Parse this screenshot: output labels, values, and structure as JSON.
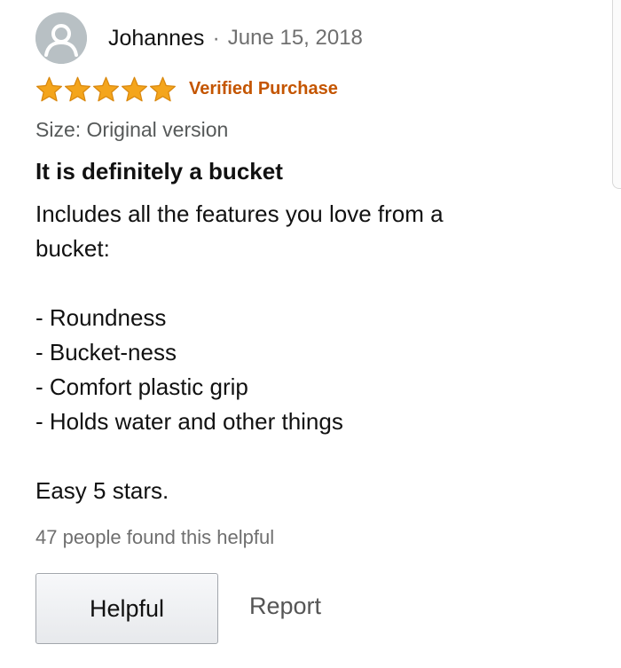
{
  "review": {
    "reviewer_name": "Johannes",
    "separator": "·",
    "date": "June 15, 2018",
    "rating": 5,
    "rating_max": 5,
    "verified_label": "Verified Purchase",
    "size_line": "Size: Original version",
    "title": "It is definitely a bucket",
    "body_lines": [
      "Includes all the features you love from a",
      "bucket:",
      "",
      "- Roundness",
      "- Bucket-ness",
      "- Comfort plastic grip",
      "- Holds water and other things",
      "",
      "Easy 5 stars."
    ],
    "helpful_count": "47 people found this helpful",
    "helpful_button": "Helpful",
    "report_link": "Report"
  },
  "colors": {
    "star": "#f4a51c",
    "star_outline": "#d9880f",
    "verified": "#c45500",
    "muted_text": "#6f6f6f",
    "avatar_bg": "#b8c0c4"
  },
  "icons": {
    "avatar": "person-icon",
    "star": "star-icon"
  }
}
